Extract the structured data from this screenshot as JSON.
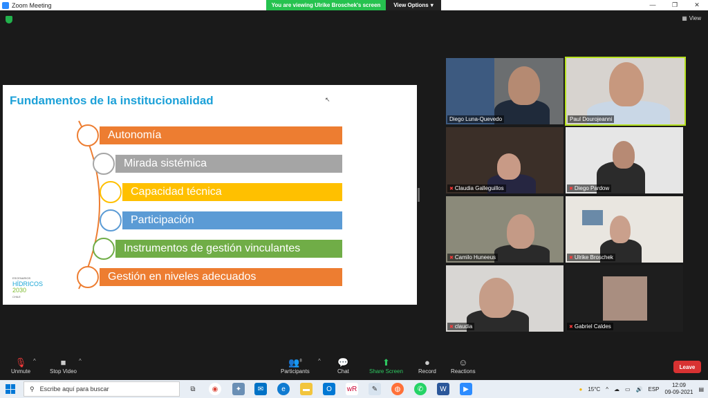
{
  "window": {
    "title": "Zoom Meeting",
    "banner": "You are viewing Ulrike Broschek's screen",
    "view_options": "View Options",
    "view_label": "View"
  },
  "slide": {
    "title": "Fundamentos de la institucionalidad",
    "items": [
      {
        "label": "Autonomía",
        "color": "#ed7d31"
      },
      {
        "label": "Mirada sistémica",
        "color": "#a5a5a5"
      },
      {
        "label": "Capacidad técnica",
        "color": "#ffc000"
      },
      {
        "label": "Participación",
        "color": "#5b9bd5"
      },
      {
        "label": "Instrumentos de gestión vinculantes",
        "color": "#70ad47"
      },
      {
        "label": "Gestión en niveles adecuados",
        "color": "#ed7d31"
      }
    ],
    "logo": {
      "line1": "ESCENARIOS",
      "line2": "HÍDRICOS",
      "line3": "2030",
      "line4": "CHILE"
    }
  },
  "participants": [
    {
      "name": "Diego Luna-Quevedo",
      "muted": false
    },
    {
      "name": "Paul Dourojeanni",
      "muted": false
    },
    {
      "name": "Claudia Galleguillos",
      "muted": true
    },
    {
      "name": "Diego Pardow",
      "muted": true
    },
    {
      "name": "Camilo Huneeus",
      "muted": true
    },
    {
      "name": "Ulrike Broschek",
      "muted": true
    },
    {
      "name": "claudia",
      "muted": true
    },
    {
      "name": "Gabriel Caldes",
      "muted": true
    }
  ],
  "toolbar": {
    "unmute": "Unmute",
    "stop_video": "Stop Video",
    "participants": "Participants",
    "participants_count": "8",
    "chat": "Chat",
    "share_screen": "Share Screen",
    "record": "Record",
    "reactions": "Reactions",
    "leave": "Leave"
  },
  "taskbar": {
    "search_placeholder": "Escribe aquí para buscar",
    "temperature": "15°C",
    "language": "ESP",
    "time": "12:09",
    "date": "09-09-2021"
  }
}
